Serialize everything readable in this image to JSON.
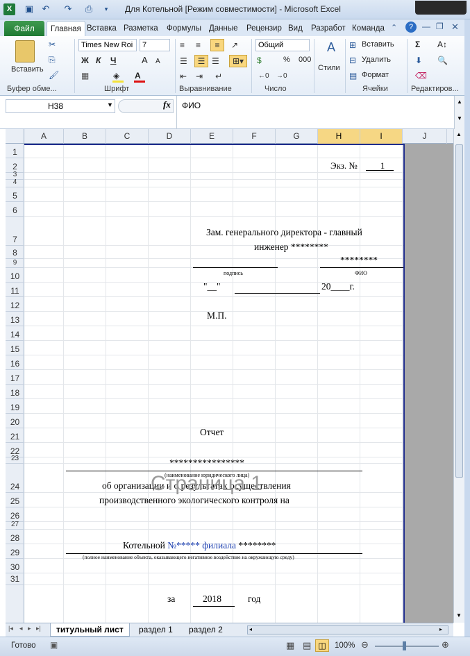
{
  "window": {
    "title": "Для Котельной  [Режим совместимости] - Microsoft Excel"
  },
  "ribbon_tabs": {
    "file": "Файл",
    "tabs": [
      "Главная",
      "Вставка",
      "Разметка",
      "Формулы",
      "Данные",
      "Рецензир",
      "Вид",
      "Разработ",
      "Команда"
    ],
    "active": "Главная"
  },
  "ribbon": {
    "paste_label": "Вставить",
    "font_name": "Times New Roi",
    "font_size": "7",
    "bold": "Ж",
    "italic": "К",
    "underline": "Ч",
    "number_format": "Общий",
    "percent": "%",
    "thousands": "000",
    "styles_label": "Стили",
    "insert_label": "Вставить",
    "delete_label": "Удалить",
    "format_label": "Формат",
    "groups": {
      "clipboard": "Буфер обме...",
      "font": "Шрифт",
      "alignment": "Выравнивание",
      "number": "Число",
      "cells": "Ячейки",
      "editing": "Редактиров..."
    }
  },
  "formula_bar": {
    "cell_ref": "H38",
    "fx": "fx",
    "content": "ФИО"
  },
  "columns": [
    "A",
    "B",
    "C",
    "D",
    "E",
    "F",
    "G",
    "H",
    "I",
    "J"
  ],
  "selected_columns": [
    "H",
    "I"
  ],
  "rows": [
    "1",
    "2",
    "3",
    "4",
    "5",
    "6",
    "7",
    "8",
    "9",
    "10",
    "11",
    "12",
    "13",
    "14",
    "15",
    "16",
    "17",
    "18",
    "19",
    "20",
    "21",
    "22",
    "23",
    "24",
    "25",
    "26",
    "27",
    "28",
    "29",
    "30",
    "31"
  ],
  "document": {
    "copy_label": "Экз. №",
    "copy_number": "1",
    "approver_line1": "Зам. генерального директора - главный",
    "approver_line2": "инженер ********",
    "approver_name": "********",
    "signature_caption": "подпись",
    "fio_caption": "ФИО",
    "date_quote_open": "\"__\"",
    "date_year_prefix": "20____г.",
    "seal": "М.П.",
    "report_title": "Отчет",
    "org_name": "****************",
    "org_caption": "(наименование юридического лица)",
    "subject_line1": "об организации и о результатах осуществления",
    "subject_line2": "производственного экологического контроля на",
    "object_prefix": "Котельной",
    "object_blue": "№***** филиала",
    "object_suffix": "********",
    "object_caption": "(полное наименование объекта, оказывающего негативное воздействие на окружающую среду)",
    "for_label": "за",
    "year": "2018",
    "year_label": "год"
  },
  "watermark": "Страница 1",
  "sheet_tabs": [
    "титульный лист",
    "раздел 1",
    "раздел 2"
  ],
  "active_sheet": "титульный лист",
  "status": {
    "ready": "Готово",
    "zoom": "100%"
  },
  "colors": {
    "accent_green": "#1f7a34",
    "page_border": "#1f2d8c",
    "blue_text": "#1c3fb0",
    "selected_header": "#f6d784"
  }
}
